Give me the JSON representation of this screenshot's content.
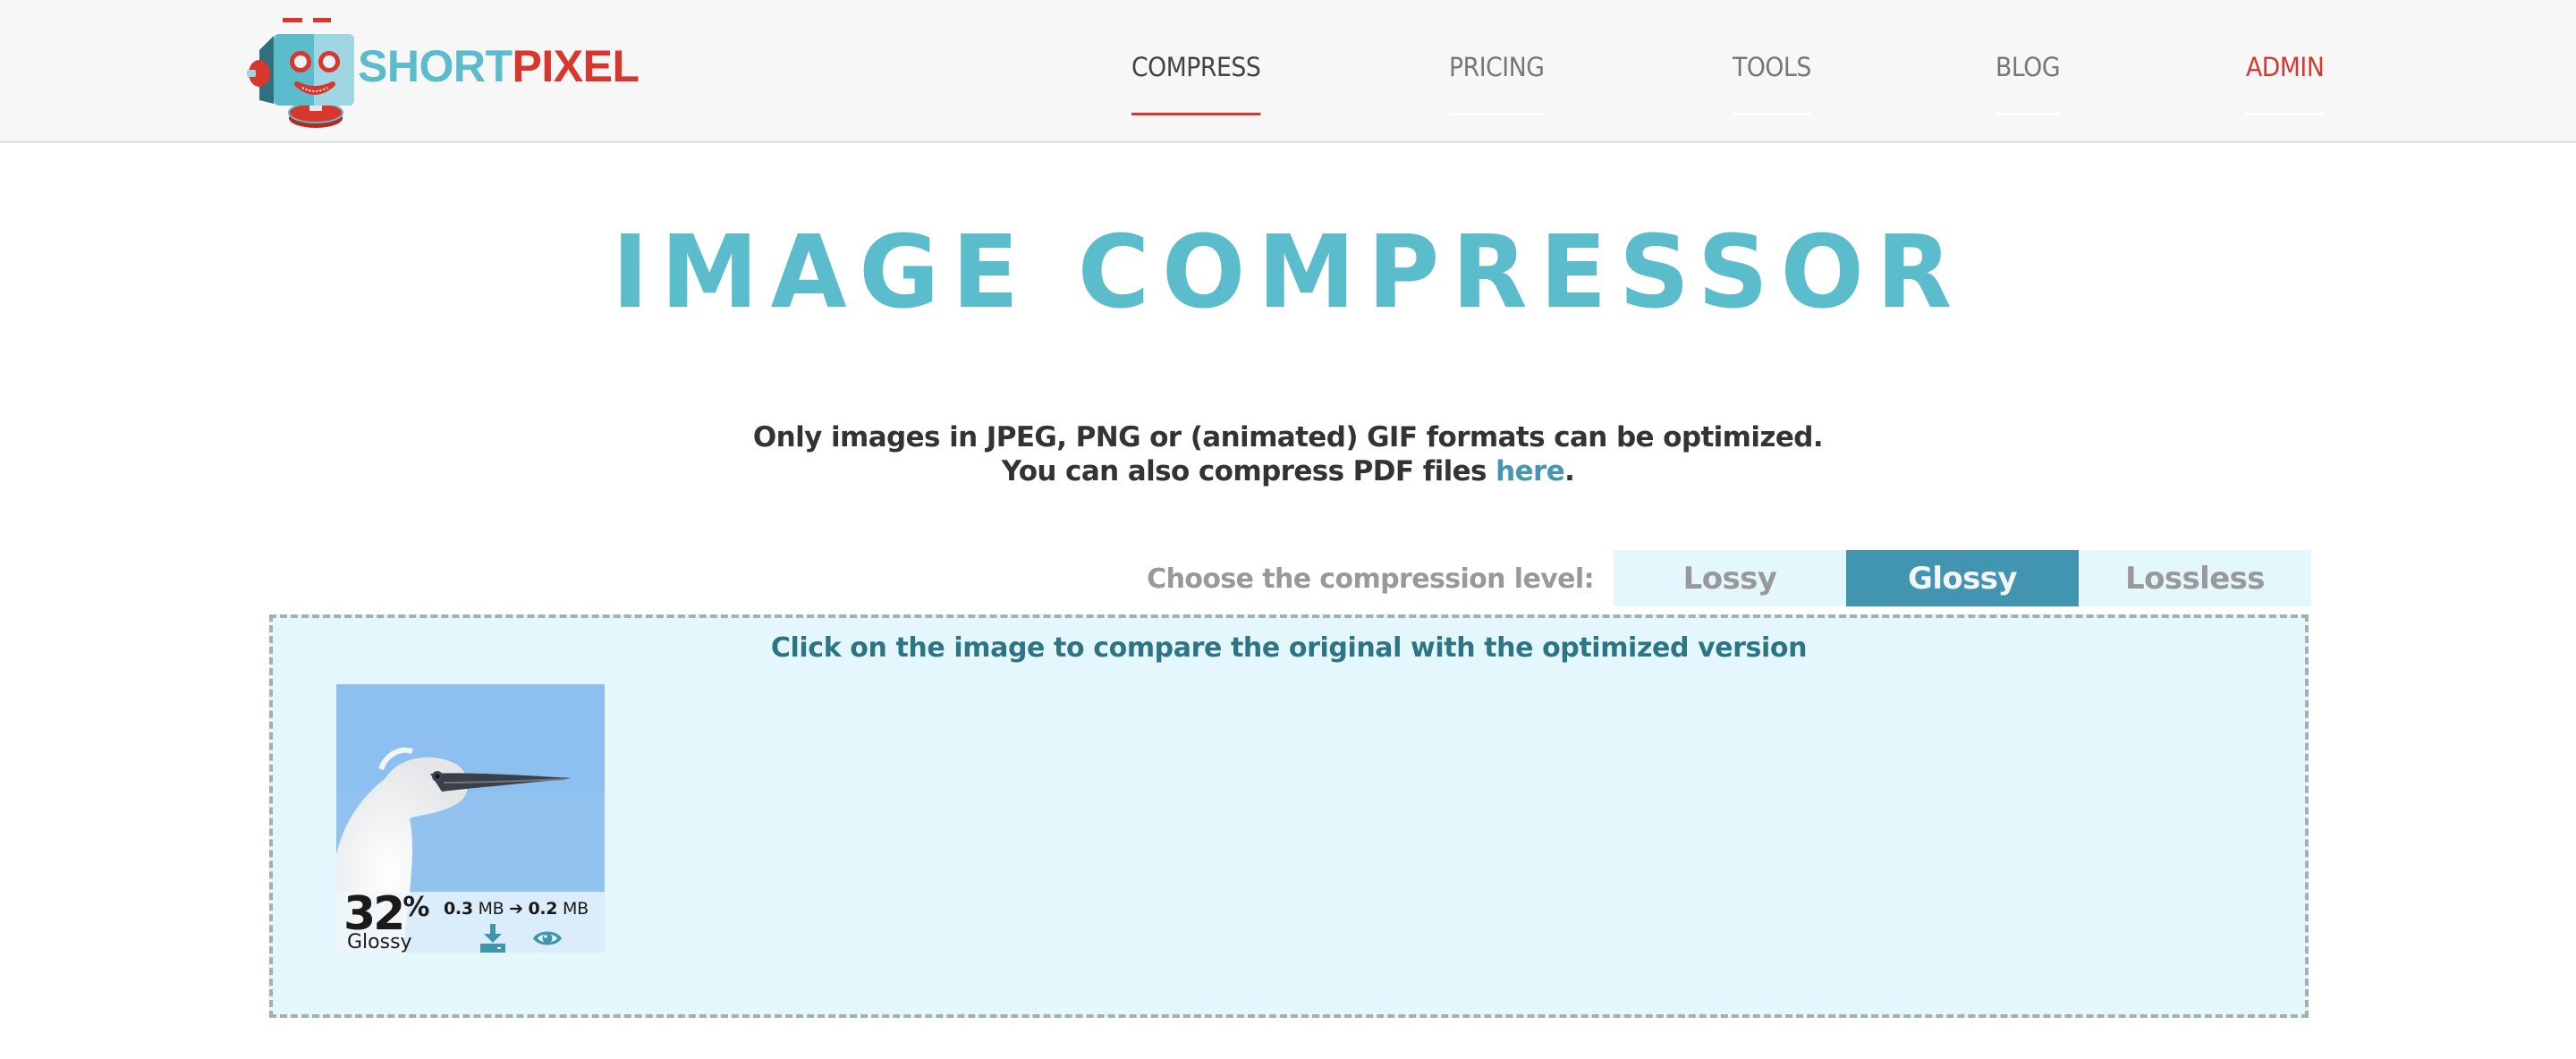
{
  "header": {
    "logo": {
      "part1": "SHORT",
      "part2": "PIXEL"
    },
    "nav": [
      {
        "label": "COMPRESS",
        "active": true
      },
      {
        "label": "PRICING",
        "active": false
      },
      {
        "label": "TOOLS",
        "active": false
      },
      {
        "label": "BLOG",
        "active": false
      },
      {
        "label": "ADMIN",
        "active": false
      }
    ]
  },
  "page": {
    "title": "IMAGE COMPRESSOR",
    "info_line1": "Only images in JPEG, PNG or (animated) GIF formats can be optimized.",
    "info_line2_prefix": "You can also compress PDF files ",
    "info_link": "here",
    "info_line2_suffix": "."
  },
  "compression": {
    "label": "Choose the compression level:",
    "options": [
      "Lossy",
      "Glossy",
      "Lossless"
    ],
    "selected": "Glossy"
  },
  "drop_area": {
    "hint": "Click on the image to compare the original with the optimized version",
    "results": [
      {
        "percent": "32",
        "percent_sign": "%",
        "level": "Glossy",
        "original_size": "0.3",
        "optimized_size": "0.2",
        "unit": "MB",
        "arrow": "➔",
        "download_icon": "download-icon",
        "view_icon": "eye-icon"
      }
    ]
  },
  "colors": {
    "brand_teal": "#5bbccc",
    "brand_red": "#d9372e",
    "selected_level": "#4295b1",
    "drop_area_bg": "#e4f7fd",
    "link": "#4596ae"
  }
}
